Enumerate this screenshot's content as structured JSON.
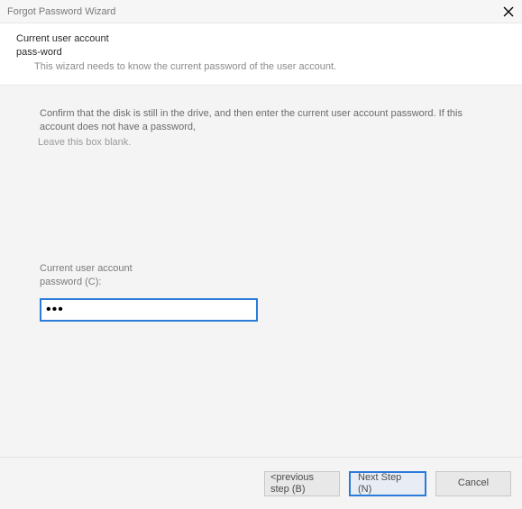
{
  "window": {
    "title": "Forgot Password Wizard"
  },
  "header": {
    "heading": "Current user account pass-word",
    "sub": "This wizard needs to know the current password of the user account."
  },
  "body": {
    "confirm1": "Confirm that the disk is still in the drive, and then enter the current user account password. If this account does not have a password,",
    "confirm2": "Leave this box blank.",
    "field_label": "Current user account password (C):",
    "password_value": "•••"
  },
  "footer": {
    "prev": "<previous step (B)",
    "next": "Next Step (N)",
    "cancel": "Cancel"
  }
}
